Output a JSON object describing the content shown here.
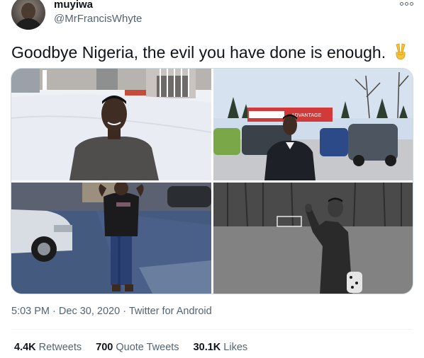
{
  "tweet": {
    "display_name": "muyiwa",
    "handle": "@MrFrancisWhyte",
    "text": "Goodbye Nigeria, the evil you have done is enough.",
    "emoji": "victory-hand-emoji",
    "time": "5:03 PM",
    "date": "Dec 30, 2020",
    "source": "Twitter for Android",
    "separator": "·",
    "stats": {
      "retweets_count": "4.4K",
      "retweets_label": "Retweets",
      "quotes_count": "700",
      "quotes_label": "Quote Tweets",
      "likes_count": "30.1K",
      "likes_label": "Likes"
    }
  },
  "media": {
    "photos": [
      "man-in-snow-photo",
      "man-in-parking-lot-photo",
      "man-on-icy-street-photo",
      "man-on-field-photo"
    ],
    "sign_text": "ADVANTAGE"
  },
  "colors": {
    "text_primary": "#0f1419",
    "text_secondary": "#536471",
    "border": "#cfd9de",
    "divider": "#eff3f4"
  }
}
